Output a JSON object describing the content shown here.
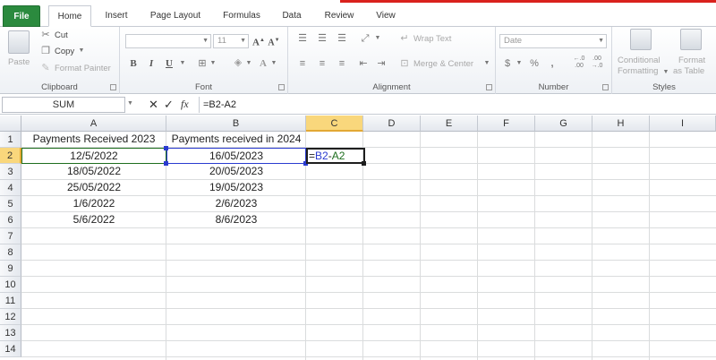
{
  "ribbon_tabs": [
    "File",
    "Home",
    "Insert",
    "Page Layout",
    "Formulas",
    "Data",
    "Review",
    "View"
  ],
  "clipboard": {
    "paste": "Paste",
    "cut": "Cut",
    "copy": "Copy",
    "format_painter": "Format Painter",
    "label": "Clipboard"
  },
  "font": {
    "size": "11",
    "label": "Font"
  },
  "alignment": {
    "wrap_text": "Wrap Text",
    "merge_center": "Merge & Center",
    "label": "Alignment"
  },
  "number": {
    "format": "Date",
    "label": "Number"
  },
  "styles": {
    "conditional": "Conditional",
    "formatting": "Formatting",
    "format_as": "Format",
    "as_table": "as Table",
    "label": "Styles"
  },
  "formula_bar": {
    "name_box": "SUM",
    "fx": "fx",
    "content": "=B2-A2"
  },
  "columns": [
    "A",
    "B",
    "C",
    "D",
    "E",
    "F",
    "G",
    "H",
    "I"
  ],
  "rows": [
    "1",
    "2",
    "3",
    "4",
    "5",
    "6",
    "7",
    "8",
    "9",
    "10",
    "11",
    "12",
    "13",
    "14"
  ],
  "cells": {
    "A1": "Payments Received 2023",
    "B1": "Payments received in 2024",
    "A2": "12/5/2022",
    "B2": "16/05/2023",
    "A3": "18/05/2022",
    "B3": "20/05/2023",
    "A4": "25/05/2022",
    "B4": "19/05/2023",
    "A5": "1/6/2022",
    "B5": "2/6/2023",
    "A6": "5/6/2022",
    "B6": "8/6/2023",
    "C2_eq": "=",
    "C2_ref1": "B2",
    "C2_minus": "-",
    "C2_ref2": "A2"
  },
  "colors": {
    "file_tab": "#2b8a3e",
    "selected_header": "#f9d77c",
    "ref_b": "#2a3bd0",
    "ref_a": "#1e6e1e"
  }
}
